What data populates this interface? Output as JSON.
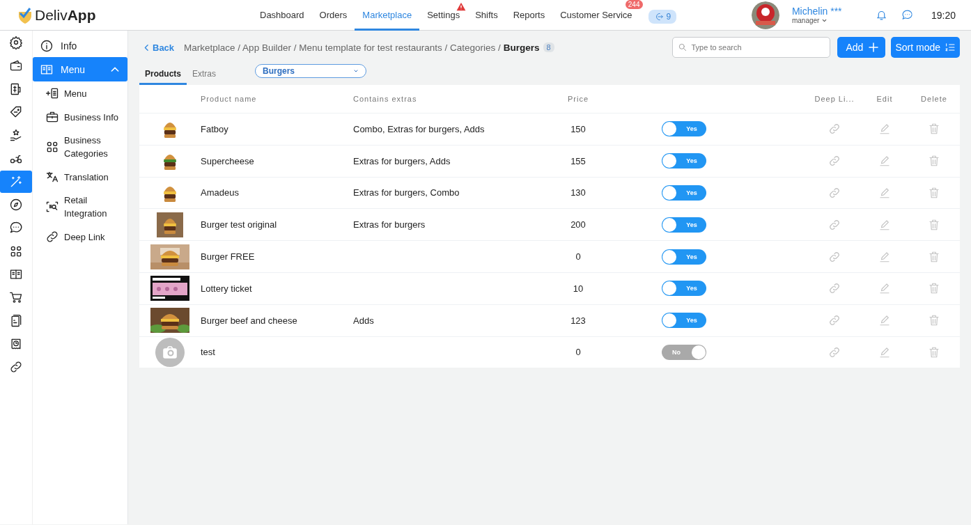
{
  "header": {
    "logo": "Deliv**App**",
    "nav": [
      {
        "label": "Dashboard",
        "selected": false
      },
      {
        "label": "Orders",
        "selected": false
      },
      {
        "label": "Marketplace",
        "selected": true
      },
      {
        "label": "Settings",
        "selected": false,
        "warning": true
      },
      {
        "label": "Shifts",
        "selected": false
      },
      {
        "label": "Reports",
        "selected": false
      },
      {
        "label": "Customer Service",
        "selected": false,
        "badge": "244"
      }
    ],
    "queue_count": "9",
    "user": {
      "name": "Michelin ***",
      "role": "manager"
    },
    "time": "19:20"
  },
  "rail": [
    {
      "selected": false
    },
    {
      "selected": false
    },
    {
      "selected": false
    },
    {
      "selected": false
    },
    {
      "selected": false
    },
    {
      "selected": false
    },
    {
      "selected": true
    },
    {
      "selected": false
    },
    {
      "selected": false
    },
    {
      "selected": false
    },
    {
      "selected": false
    },
    {
      "selected": false
    },
    {
      "selected": false
    },
    {
      "selected": false
    },
    {
      "selected": false
    }
  ],
  "sidebar": {
    "items": [
      {
        "label": "Info",
        "selected": false
      },
      {
        "label": "Menu",
        "selected": true,
        "expanded": true,
        "children": [
          {
            "label": "Menu",
            "selected": false
          },
          {
            "label": "Business Info",
            "selected": false
          },
          {
            "label": "Business Categories",
            "selected": false
          },
          {
            "label": "Translation",
            "selected": false
          },
          {
            "label": "Retail Integration",
            "selected": false
          },
          {
            "label": "Deep Link",
            "selected": false
          }
        ]
      }
    ]
  },
  "toolbar": {
    "back": "Back",
    "breadcrumb": "Marketplace / App Builder / Menu template for test restaurants / Categories /",
    "current": "Burgers",
    "count": "8",
    "search_placeholder": "Type to search",
    "buttons": [
      "Add",
      "Sort mode"
    ]
  },
  "tabs": [
    {
      "label": "Products",
      "selected": true
    },
    {
      "label": "Extras",
      "selected": false
    }
  ],
  "category_select": "Burgers",
  "table": {
    "columns": [
      "Product name",
      "Contains extras",
      "Price",
      "Deep Li...",
      "Edit",
      "Delete"
    ],
    "rows": [
      {
        "kind": "picture",
        "name": "Fatboy",
        "extras": "Combo, Extras for burgers, Adds",
        "price": "150",
        "toggle": {
          "on": true,
          "label": "Yes"
        }
      },
      {
        "kind": "picture",
        "name": "Supercheese",
        "extras": "Extras for burgers, Adds",
        "price": "155",
        "toggle": {
          "on": true,
          "label": "Yes"
        }
      },
      {
        "kind": "picture",
        "name": "Amadeus",
        "extras": "Extras for burgers, Combo",
        "price": "130",
        "toggle": {
          "on": true,
          "label": "Yes"
        }
      },
      {
        "kind": "picture",
        "name": "Burger test original",
        "extras": "Extras for burgers",
        "price": "200",
        "toggle": {
          "on": true,
          "label": "Yes"
        }
      },
      {
        "kind": "picture",
        "name": "Burger FREE",
        "price": "0",
        "toggle": {
          "on": true,
          "label": "Yes"
        }
      },
      {
        "kind": "picture",
        "name": "Lottery ticket",
        "price": "10",
        "toggle": {
          "on": true,
          "label": "Yes"
        }
      },
      {
        "kind": "picture",
        "name": "Burger beef and cheese",
        "extras": "Adds",
        "price": "123",
        "toggle": {
          "on": true,
          "label": "Yes"
        }
      },
      {
        "kind": "placeholder",
        "name": "test",
        "price": "0",
        "toggle": {
          "on": false,
          "label": "No"
        }
      }
    ]
  }
}
